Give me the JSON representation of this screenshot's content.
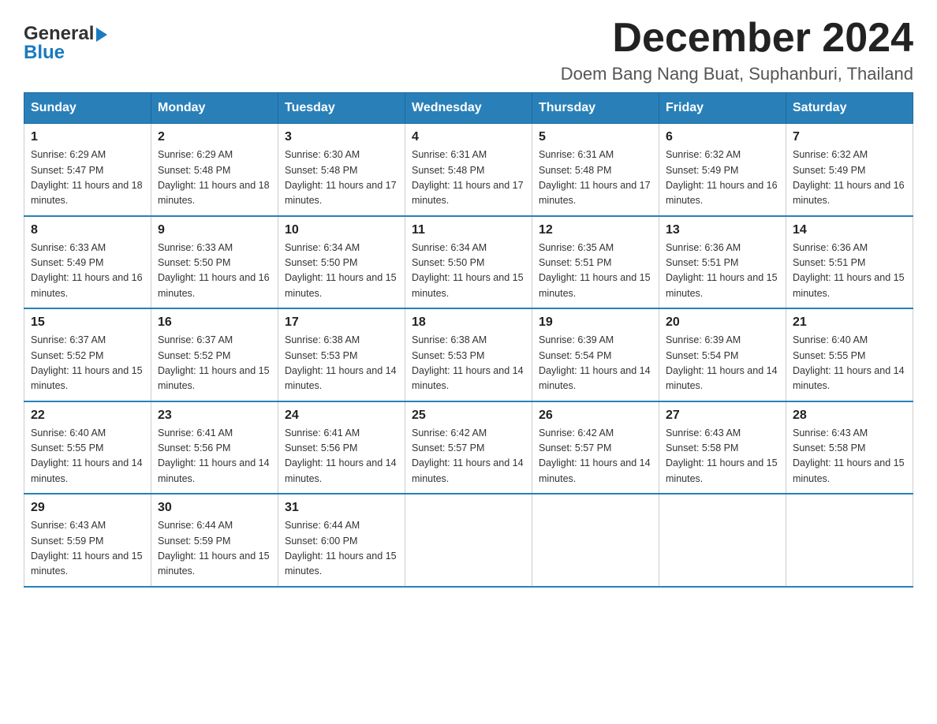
{
  "header": {
    "logo_general": "General",
    "logo_blue": "Blue",
    "month_title": "December 2024",
    "location": "Doem Bang Nang Buat, Suphanburi, Thailand"
  },
  "weekdays": [
    "Sunday",
    "Monday",
    "Tuesday",
    "Wednesday",
    "Thursday",
    "Friday",
    "Saturday"
  ],
  "weeks": [
    [
      {
        "day": "1",
        "sunrise": "Sunrise: 6:29 AM",
        "sunset": "Sunset: 5:47 PM",
        "daylight": "Daylight: 11 hours and 18 minutes."
      },
      {
        "day": "2",
        "sunrise": "Sunrise: 6:29 AM",
        "sunset": "Sunset: 5:48 PM",
        "daylight": "Daylight: 11 hours and 18 minutes."
      },
      {
        "day": "3",
        "sunrise": "Sunrise: 6:30 AM",
        "sunset": "Sunset: 5:48 PM",
        "daylight": "Daylight: 11 hours and 17 minutes."
      },
      {
        "day": "4",
        "sunrise": "Sunrise: 6:31 AM",
        "sunset": "Sunset: 5:48 PM",
        "daylight": "Daylight: 11 hours and 17 minutes."
      },
      {
        "day": "5",
        "sunrise": "Sunrise: 6:31 AM",
        "sunset": "Sunset: 5:48 PM",
        "daylight": "Daylight: 11 hours and 17 minutes."
      },
      {
        "day": "6",
        "sunrise": "Sunrise: 6:32 AM",
        "sunset": "Sunset: 5:49 PM",
        "daylight": "Daylight: 11 hours and 16 minutes."
      },
      {
        "day": "7",
        "sunrise": "Sunrise: 6:32 AM",
        "sunset": "Sunset: 5:49 PM",
        "daylight": "Daylight: 11 hours and 16 minutes."
      }
    ],
    [
      {
        "day": "8",
        "sunrise": "Sunrise: 6:33 AM",
        "sunset": "Sunset: 5:49 PM",
        "daylight": "Daylight: 11 hours and 16 minutes."
      },
      {
        "day": "9",
        "sunrise": "Sunrise: 6:33 AM",
        "sunset": "Sunset: 5:50 PM",
        "daylight": "Daylight: 11 hours and 16 minutes."
      },
      {
        "day": "10",
        "sunrise": "Sunrise: 6:34 AM",
        "sunset": "Sunset: 5:50 PM",
        "daylight": "Daylight: 11 hours and 15 minutes."
      },
      {
        "day": "11",
        "sunrise": "Sunrise: 6:34 AM",
        "sunset": "Sunset: 5:50 PM",
        "daylight": "Daylight: 11 hours and 15 minutes."
      },
      {
        "day": "12",
        "sunrise": "Sunrise: 6:35 AM",
        "sunset": "Sunset: 5:51 PM",
        "daylight": "Daylight: 11 hours and 15 minutes."
      },
      {
        "day": "13",
        "sunrise": "Sunrise: 6:36 AM",
        "sunset": "Sunset: 5:51 PM",
        "daylight": "Daylight: 11 hours and 15 minutes."
      },
      {
        "day": "14",
        "sunrise": "Sunrise: 6:36 AM",
        "sunset": "Sunset: 5:51 PM",
        "daylight": "Daylight: 11 hours and 15 minutes."
      }
    ],
    [
      {
        "day": "15",
        "sunrise": "Sunrise: 6:37 AM",
        "sunset": "Sunset: 5:52 PM",
        "daylight": "Daylight: 11 hours and 15 minutes."
      },
      {
        "day": "16",
        "sunrise": "Sunrise: 6:37 AM",
        "sunset": "Sunset: 5:52 PM",
        "daylight": "Daylight: 11 hours and 15 minutes."
      },
      {
        "day": "17",
        "sunrise": "Sunrise: 6:38 AM",
        "sunset": "Sunset: 5:53 PM",
        "daylight": "Daylight: 11 hours and 14 minutes."
      },
      {
        "day": "18",
        "sunrise": "Sunrise: 6:38 AM",
        "sunset": "Sunset: 5:53 PM",
        "daylight": "Daylight: 11 hours and 14 minutes."
      },
      {
        "day": "19",
        "sunrise": "Sunrise: 6:39 AM",
        "sunset": "Sunset: 5:54 PM",
        "daylight": "Daylight: 11 hours and 14 minutes."
      },
      {
        "day": "20",
        "sunrise": "Sunrise: 6:39 AM",
        "sunset": "Sunset: 5:54 PM",
        "daylight": "Daylight: 11 hours and 14 minutes."
      },
      {
        "day": "21",
        "sunrise": "Sunrise: 6:40 AM",
        "sunset": "Sunset: 5:55 PM",
        "daylight": "Daylight: 11 hours and 14 minutes."
      }
    ],
    [
      {
        "day": "22",
        "sunrise": "Sunrise: 6:40 AM",
        "sunset": "Sunset: 5:55 PM",
        "daylight": "Daylight: 11 hours and 14 minutes."
      },
      {
        "day": "23",
        "sunrise": "Sunrise: 6:41 AM",
        "sunset": "Sunset: 5:56 PM",
        "daylight": "Daylight: 11 hours and 14 minutes."
      },
      {
        "day": "24",
        "sunrise": "Sunrise: 6:41 AM",
        "sunset": "Sunset: 5:56 PM",
        "daylight": "Daylight: 11 hours and 14 minutes."
      },
      {
        "day": "25",
        "sunrise": "Sunrise: 6:42 AM",
        "sunset": "Sunset: 5:57 PM",
        "daylight": "Daylight: 11 hours and 14 minutes."
      },
      {
        "day": "26",
        "sunrise": "Sunrise: 6:42 AM",
        "sunset": "Sunset: 5:57 PM",
        "daylight": "Daylight: 11 hours and 14 minutes."
      },
      {
        "day": "27",
        "sunrise": "Sunrise: 6:43 AM",
        "sunset": "Sunset: 5:58 PM",
        "daylight": "Daylight: 11 hours and 15 minutes."
      },
      {
        "day": "28",
        "sunrise": "Sunrise: 6:43 AM",
        "sunset": "Sunset: 5:58 PM",
        "daylight": "Daylight: 11 hours and 15 minutes."
      }
    ],
    [
      {
        "day": "29",
        "sunrise": "Sunrise: 6:43 AM",
        "sunset": "Sunset: 5:59 PM",
        "daylight": "Daylight: 11 hours and 15 minutes."
      },
      {
        "day": "30",
        "sunrise": "Sunrise: 6:44 AM",
        "sunset": "Sunset: 5:59 PM",
        "daylight": "Daylight: 11 hours and 15 minutes."
      },
      {
        "day": "31",
        "sunrise": "Sunrise: 6:44 AM",
        "sunset": "Sunset: 6:00 PM",
        "daylight": "Daylight: 11 hours and 15 minutes."
      },
      null,
      null,
      null,
      null
    ]
  ]
}
